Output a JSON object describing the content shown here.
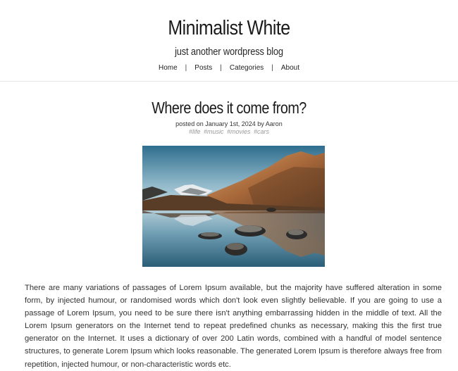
{
  "site": {
    "title": "Minimalist White",
    "tagline": "just another wordpress blog"
  },
  "nav": {
    "items": [
      "Home",
      "Posts",
      "Categories",
      "About"
    ],
    "separator": "|"
  },
  "post": {
    "title": "Where does it come from?",
    "meta_prefix": "posted on ",
    "date": "January 1st, 2024",
    "meta_by": " by ",
    "author": "Aaron",
    "tags": [
      "#life",
      "#music",
      "#movies",
      "#cars"
    ],
    "body": "There are many variations of passages of Lorem Ipsum available, but the majority have suffered alteration in some form, by injected humour, or randomised words which don't look even slightly believable. If you are going to use a passage of Lorem Ipsum, you need to be sure there isn't anything embarrassing hidden in the middle of text. All the Lorem Ipsum generators on the Internet tend to repeat predefined chunks as necessary, making this the first true generator on the Internet. It uses a dictionary of over 200 Latin words, combined with a handful of model sentence structures, to generate Lorem Ipsum which looks reasonable. The generated Lorem Ipsum is therefore always free from repetition, injected humour, or non-characteristic words etc."
  },
  "colors": {
    "background": "#ffffff",
    "text": "#222222",
    "tag": "#999999",
    "divider": "#e6e6e6"
  }
}
